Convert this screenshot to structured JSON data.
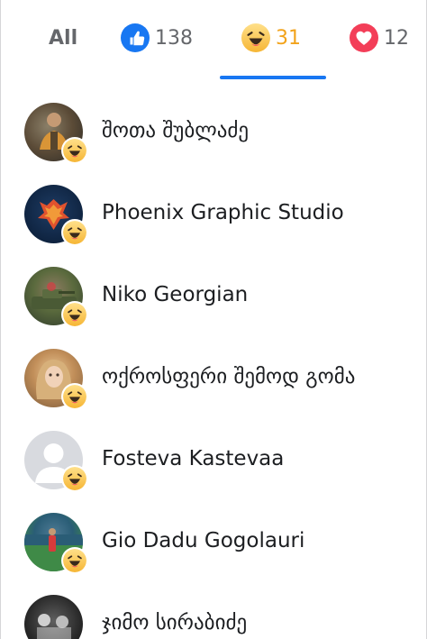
{
  "tabs": {
    "all": {
      "label": "All",
      "icon": null,
      "active": false
    },
    "like": {
      "icon": "like-thumb-icon",
      "count": "138",
      "color": "#1877f2",
      "active": false
    },
    "haha": {
      "icon": "haha-emoji-icon",
      "count": "31",
      "color": "#f2a31b",
      "active": true
    },
    "love": {
      "icon": "love-heart-icon",
      "count": "12",
      "color": "#f33e58",
      "active": false
    }
  },
  "colors": {
    "accent": "#1877f2",
    "haha": "#f2a31b",
    "like": "#1877f2",
    "love": "#f33e58",
    "text": "#1c1e21",
    "muted": "#65676b"
  },
  "people": [
    {
      "name": "შოთა შუბლაძე",
      "reaction": "haha-emoji-icon"
    },
    {
      "name": "Phoenix Graphic Studio",
      "reaction": "haha-emoji-icon"
    },
    {
      "name": "Niko Georgian",
      "reaction": "haha-emoji-icon"
    },
    {
      "name": "ოქროსფერი შემოდ გომა",
      "reaction": "haha-emoji-icon"
    },
    {
      "name": "Fosteva Kastevaa",
      "reaction": "haha-emoji-icon"
    },
    {
      "name": "Gio Dadu Gogolauri",
      "reaction": "haha-emoji-icon"
    },
    {
      "name": "ჯიმო სირაბიძე",
      "reaction": null
    }
  ]
}
